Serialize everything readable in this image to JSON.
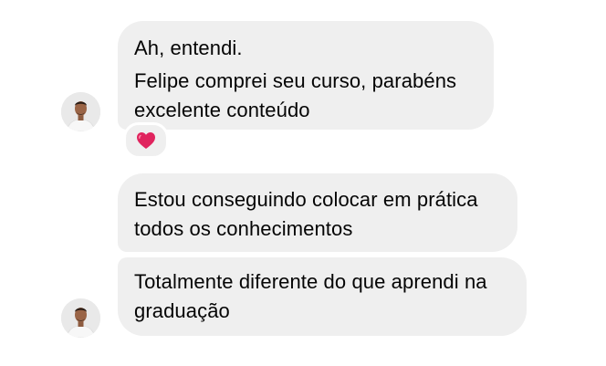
{
  "conversation": {
    "messages": [
      {
        "lines": [
          "Ah, entendi.",
          "Felipe comprei seu curso, parabéns",
          "excelente conteúdo"
        ],
        "reaction": "red-heart"
      },
      {
        "lines": [
          "Estou conseguindo colocar em prática",
          "todos os conhecimentos"
        ]
      },
      {
        "lines": [
          "Totalmente diferente do que aprendi na",
          "graduação"
        ]
      }
    ]
  },
  "colors": {
    "bubble_background": "#efefef",
    "text": "#050505",
    "heart": "#e0245e"
  }
}
